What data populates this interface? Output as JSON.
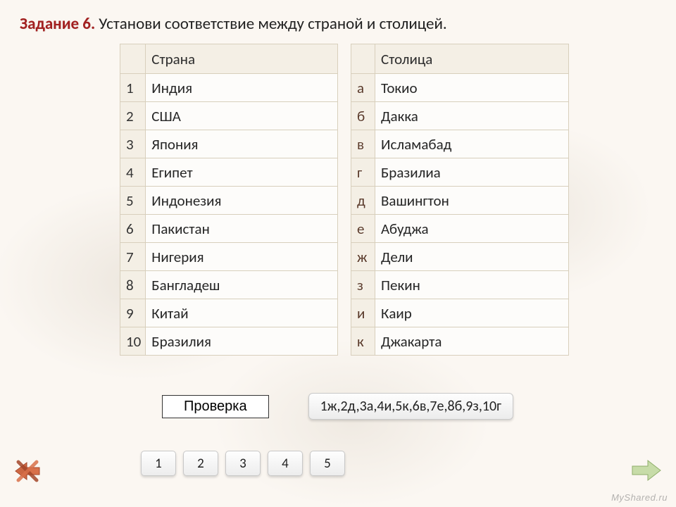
{
  "title": {
    "lead": "Задание 6.",
    "rest": " Установи соответствие между страной и столицей."
  },
  "countries": {
    "header": "Страна",
    "rows": [
      {
        "idx": "1",
        "val": "Индия"
      },
      {
        "idx": "2",
        "val": "США"
      },
      {
        "idx": "3",
        "val": "Япония"
      },
      {
        "idx": "4",
        "val": "Египет"
      },
      {
        "idx": "5",
        "val": "Индонезия"
      },
      {
        "idx": "6",
        "val": "Пакистан"
      },
      {
        "idx": "7",
        "val": "Нигерия"
      },
      {
        "idx": "8",
        "val": "Бангладеш"
      },
      {
        "idx": "9",
        "val": "Китай"
      },
      {
        "idx": "10",
        "val": "Бразилия"
      }
    ]
  },
  "capitals": {
    "header": "Столица",
    "rows": [
      {
        "idx": "а",
        "val": "Токио"
      },
      {
        "idx": "б",
        "val": "Дакка"
      },
      {
        "idx": "в",
        "val": "Исламабад"
      },
      {
        "idx": "г",
        "val": "Бразилиа"
      },
      {
        "idx": "д",
        "val": "Вашингтон"
      },
      {
        "idx": "е",
        "val": "Абуджа"
      },
      {
        "idx": "ж",
        "val": "Дели"
      },
      {
        "idx": "з",
        "val": "Пекин"
      },
      {
        "idx": "и",
        "val": "Каир"
      },
      {
        "idx": "к",
        "val": "Джакарта"
      }
    ]
  },
  "check_label": "Проверка",
  "answer": "1ж,2д,3а,4и,5к,6в,7е,8б,9з,10г",
  "pages": [
    "1",
    "2",
    "3",
    "4",
    "5"
  ],
  "watermark": "MyShared.ru"
}
